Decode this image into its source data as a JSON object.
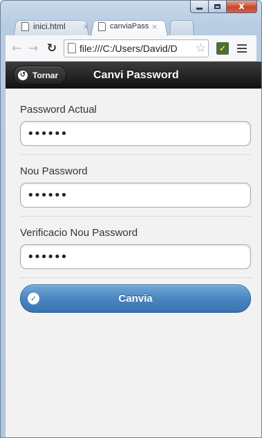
{
  "browser": {
    "tabs": [
      {
        "title": "inici.html",
        "close": "×"
      },
      {
        "title": "canviaPass",
        "close": "×"
      }
    ],
    "address": "file:///C:/Users/David/D",
    "caption_close": "x"
  },
  "page": {
    "back_label": "Tornar",
    "title": "Canvi Password",
    "fields": [
      {
        "label": "Password Actual",
        "value": "••••••"
      },
      {
        "label": "Nou Password",
        "value": "••••••"
      },
      {
        "label": "Verificacio Nou Password",
        "value": "••••••"
      }
    ],
    "submit_label": "Canvia"
  }
}
